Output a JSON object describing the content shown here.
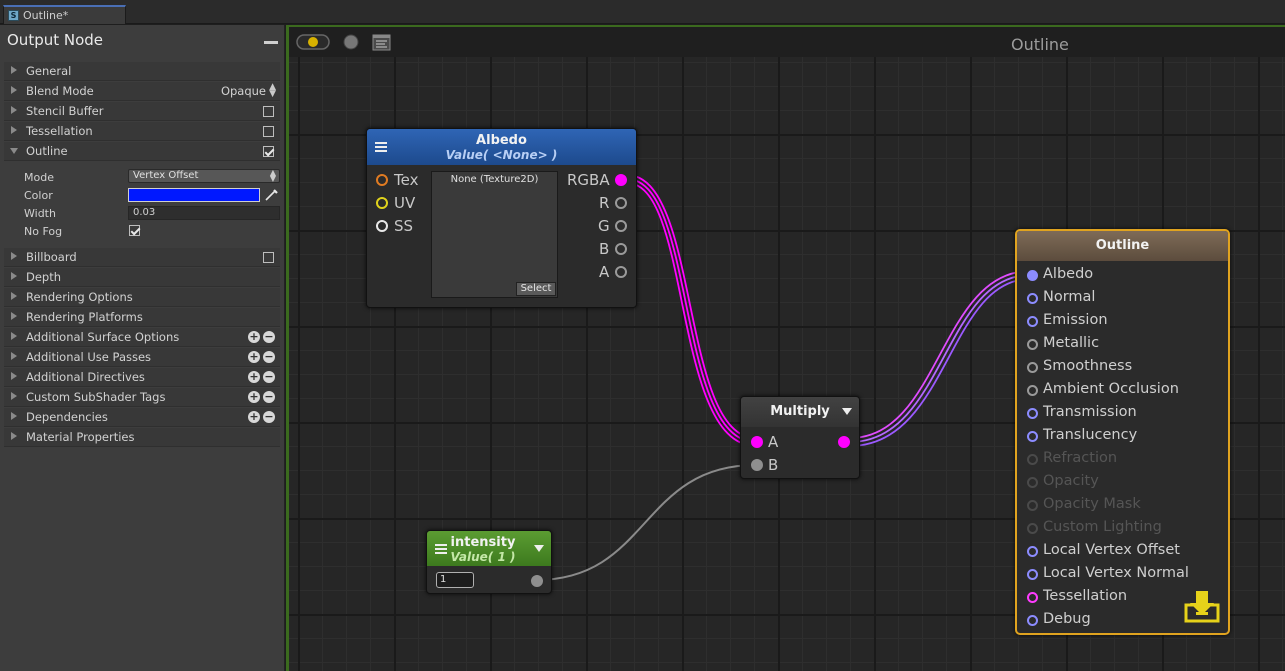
{
  "tab": {
    "label": "Outline*",
    "icon": "S"
  },
  "panel": {
    "title": "Output Node",
    "rows": {
      "general": "General",
      "blend_mode": "Blend Mode",
      "blend_mode_value": "Opaque",
      "stencil_buffer": "Stencil Buffer",
      "tessellation": "Tessellation",
      "outline": "Outline",
      "billboard": "Billboard",
      "depth": "Depth",
      "rendering_options": "Rendering Options",
      "rendering_platforms": "Rendering Platforms",
      "additional_surface_options": "Additional Surface Options",
      "additional_use_passes": "Additional Use Passes",
      "additional_directives": "Additional Directives",
      "custom_subshader_tags": "Custom SubShader Tags",
      "dependencies": "Dependencies",
      "material_properties": "Material Properties"
    },
    "outline": {
      "mode_label": "Mode",
      "mode_value": "Vertex Offset",
      "color_label": "Color",
      "color_value": "#0018ff",
      "width_label": "Width",
      "width_value": "0.03",
      "nofog_label": "No Fog",
      "nofog_checked": true
    },
    "checks": {
      "stencil_buffer": false,
      "tessellation": false,
      "outline": true,
      "billboard": false
    }
  },
  "canvas": {
    "title": "Outline"
  },
  "nodes": {
    "albedo": {
      "title": "Albedo",
      "subtitle": "Value( <None> )",
      "inputs": [
        "Tex",
        "UV",
        "SS"
      ],
      "outputs": [
        "RGBA",
        "R",
        "G",
        "B",
        "A"
      ],
      "preview_label": "None (Texture2D)",
      "select_label": "Select"
    },
    "multiply": {
      "title": "Multiply",
      "inputs": [
        "A",
        "B"
      ]
    },
    "intensity": {
      "title": "intensity",
      "subtitle": "Value( 1 )",
      "value": "1"
    },
    "output": {
      "title": "Outline",
      "ports": [
        "Albedo",
        "Normal",
        "Emission",
        "Metallic",
        "Smoothness",
        "Ambient Occlusion",
        "Transmission",
        "Translucency",
        "Refraction",
        "Opacity",
        "Opacity Mask",
        "Custom Lighting",
        "Local Vertex Offset",
        "Local Vertex Normal",
        "Tessellation",
        "Debug"
      ]
    }
  },
  "colors": {
    "accent": "#e0a31f",
    "wire_magenta": "#ff00ff",
    "wire_purple": "#9b59ff",
    "albedo_header": "#2f65b5",
    "intensity_header": "#5b9c32"
  }
}
